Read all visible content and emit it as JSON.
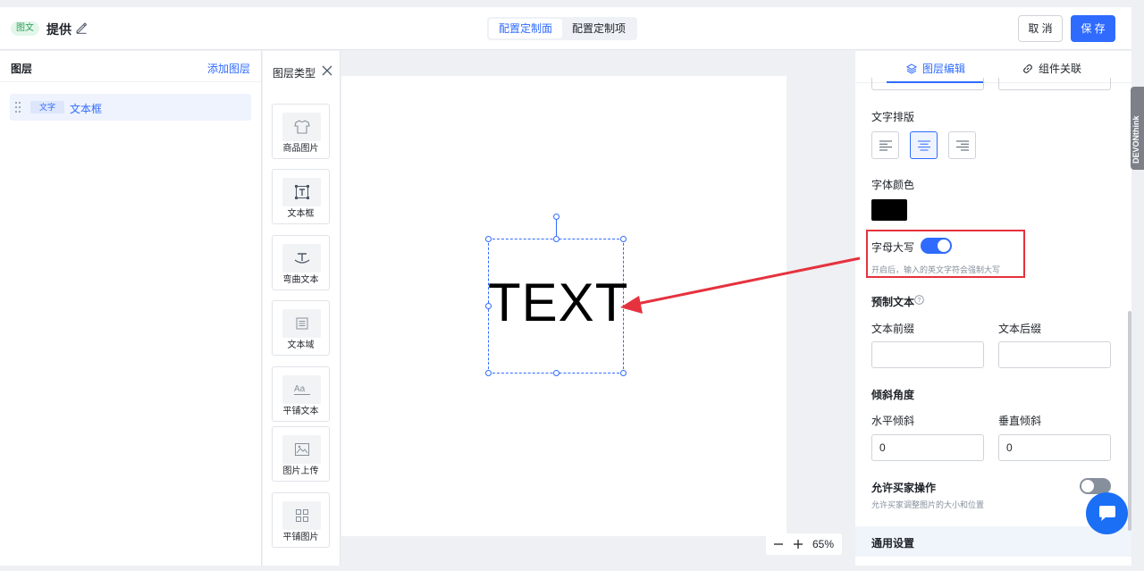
{
  "header": {
    "tag": "图文",
    "title": "提供",
    "tabs": [
      {
        "label": "配置定制面",
        "active": true
      },
      {
        "label": "配置定制项",
        "active": false
      }
    ],
    "cancel_label": "取 消",
    "save_label": "保 存"
  },
  "layers": {
    "title": "图层",
    "add_label": "添加图层",
    "items": [
      {
        "tag": "文字",
        "name": "文本框"
      }
    ]
  },
  "layer_types": {
    "title": "图层类型",
    "items": [
      {
        "label": "商品图片",
        "icon": "tshirt-icon"
      },
      {
        "label": "文本框",
        "icon": "text-box-icon"
      },
      {
        "label": "弯曲文本",
        "icon": "curved-text-icon"
      },
      {
        "label": "文本域",
        "icon": "text-area-icon"
      },
      {
        "label": "平铺文本",
        "icon": "tiled-text-icon"
      },
      {
        "label": "图片上传",
        "icon": "image-upload-icon"
      },
      {
        "label": "平铺图片",
        "icon": "tiled-image-icon"
      }
    ]
  },
  "canvas": {
    "text": "TEXT",
    "zoom": "65%"
  },
  "props": {
    "tabs": [
      {
        "label": "图层编辑",
        "active": true
      },
      {
        "label": "组件关联",
        "active": false
      }
    ],
    "text_align_label": "文字排版",
    "text_align_selected": "center",
    "font_color_label": "字体颜色",
    "font_color": "#000000",
    "uppercase_label": "字母大写",
    "uppercase_enabled": true,
    "uppercase_hint": "开启后，输入的英文字符会强制大写",
    "preset_text_label": "预制文本",
    "prefix_label": "文本前缀",
    "prefix_value": "",
    "suffix_label": "文本后缀",
    "suffix_value": "",
    "skew_label": "倾斜角度",
    "skew_h_label": "水平倾斜",
    "skew_h_value": "0",
    "skew_v_label": "垂直倾斜",
    "skew_v_value": "0",
    "buyer_op_label": "允许买家操作",
    "buyer_op_enabled": false,
    "buyer_op_hint": "允许买家调整图片的大小和位置",
    "general_label": "通用设置"
  },
  "sidebar_tab": "DEVONthink",
  "colors": {
    "accent": "#2f6bff",
    "annotation": "#e5323e"
  }
}
